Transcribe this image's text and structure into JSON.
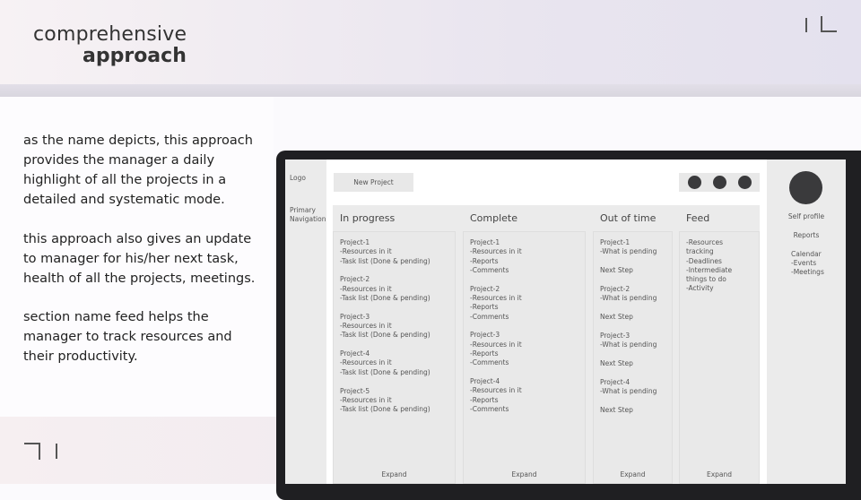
{
  "slide": {
    "title_line1": "comprehensive",
    "title_line2": "approach",
    "paragraphs": [
      "as the name depicts, this approach provides the manager a daily highlight of all the projects in a detailed and systematic mode.",
      "this approach also gives an update to manager for his/her next task, health of all the projects, meetings.",
      "section name feed helps the manager to track resources and their productivity."
    ]
  },
  "mockup": {
    "nav": {
      "logo": "Logo",
      "primary_line1": "Primary",
      "primary_line2": "Navigation"
    },
    "new_project": "New Project",
    "columns": [
      {
        "title": "In progress",
        "blocks": [
          [
            "Project-1",
            "-Resources in it",
            "-Task list (Done & pending)"
          ],
          [
            "Project-2",
            "-Resources in it",
            "-Task list (Done & pending)"
          ],
          [
            "Project-3",
            "-Resources in it",
            "-Task list (Done & pending)"
          ],
          [
            "Project-4",
            "-Resources in it",
            "-Task list (Done & pending)"
          ],
          [
            "Project-5",
            "-Resources in it",
            "-Task list (Done & pending)"
          ]
        ],
        "expand": "Expand"
      },
      {
        "title": "Complete",
        "blocks": [
          [
            "Project-1",
            "-Resources in it",
            "-Reports",
            "-Comments"
          ],
          [
            "Project-2",
            "-Resources in it",
            "-Reports",
            "-Comments"
          ],
          [
            "Project-3",
            "-Resources in it",
            "-Reports",
            "-Comments"
          ],
          [
            "Project-4",
            "-Resources in it",
            "-Reports",
            "-Comments"
          ]
        ],
        "expand": "Expand"
      },
      {
        "title": "Out of time",
        "blocks": [
          [
            "Project-1",
            "-What is pending"
          ],
          [
            "Next Step"
          ],
          [
            "Project-2",
            "-What is pending"
          ],
          [
            "Next Step"
          ],
          [
            "Project-3",
            "-What is pending"
          ],
          [
            "Next Step"
          ],
          [
            "Project-4",
            "-What is pending"
          ],
          [
            "Next Step"
          ]
        ],
        "expand": "Expand"
      },
      {
        "title": "Feed",
        "blocks": [
          [
            "-Resources tracking",
            "-Deadlines",
            "-Intermediate things to do",
            "-Activity"
          ]
        ],
        "expand": "Expand"
      }
    ],
    "right": {
      "self_profile": "Self profile",
      "reports": "Reports",
      "calendar": "Calendar",
      "events": "-Events",
      "meetings": "-Meetings"
    }
  }
}
